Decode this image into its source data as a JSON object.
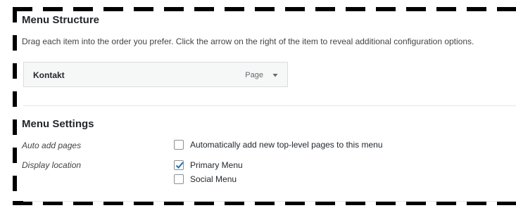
{
  "menu_structure": {
    "title": "Menu Structure",
    "description": "Drag each item into the order you prefer. Click the arrow on the right of the item to reveal additional configuration options.",
    "items": [
      {
        "title": "Kontakt",
        "type": "Page",
        "icon": "triangle-down-icon"
      }
    ]
  },
  "menu_settings": {
    "title": "Menu Settings",
    "auto_add": {
      "label": "Auto add pages",
      "option": "Automatically add new top-level pages to this menu",
      "checked": false
    },
    "display_location": {
      "label": "Display location",
      "options": [
        {
          "label": "Primary Menu",
          "checked": true
        },
        {
          "label": "Social Menu",
          "checked": false
        }
      ]
    }
  },
  "colors": {
    "accent": "#2271b1",
    "selection_border": "#000000"
  }
}
